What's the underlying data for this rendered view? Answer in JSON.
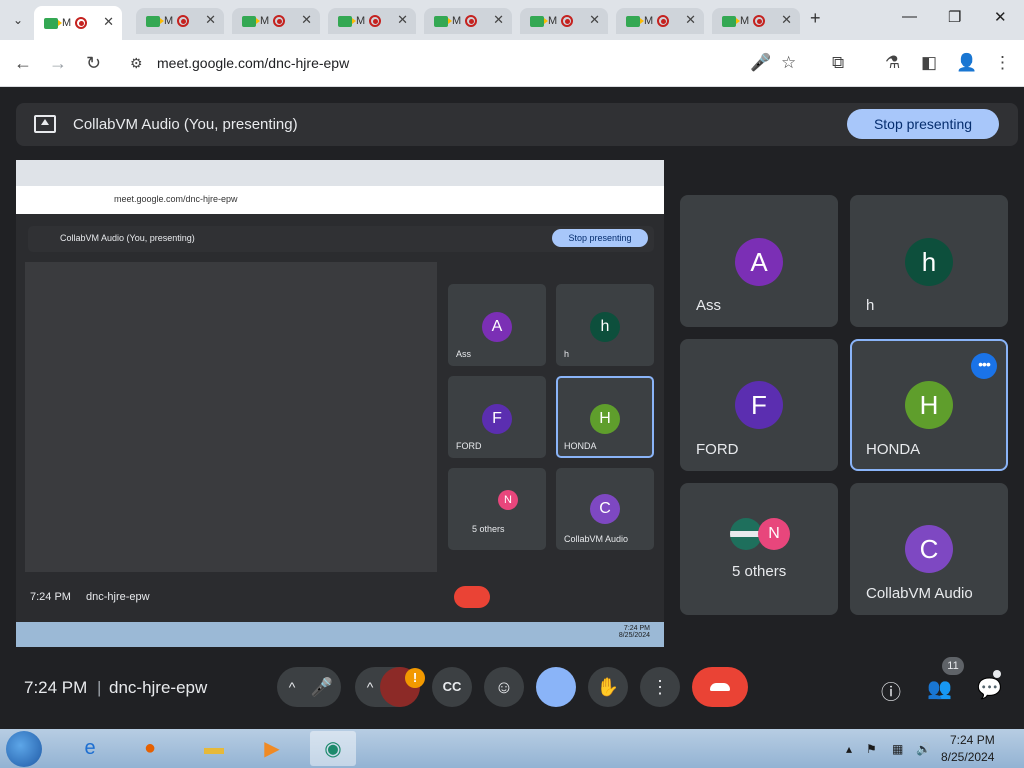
{
  "browser": {
    "tab_label": "M",
    "url": "meet.google.com/dnc-hjre-epw",
    "new_tab": "+",
    "close": "✕",
    "minimize": "—",
    "restore": "❐"
  },
  "presenting_bar": {
    "title": "CollabVM Audio (You, presenting)",
    "stop_label": "Stop presenting"
  },
  "participants": [
    {
      "initial": "A",
      "name": "Ass",
      "color": "#7b2fb5"
    },
    {
      "initial": "h",
      "name": "h",
      "color": "#0d4f3c"
    },
    {
      "initial": "F",
      "name": "FORD",
      "color": "#5b2eb0"
    },
    {
      "initial": "H",
      "name": "HONDA",
      "color": "#5f9e2c"
    },
    {
      "initial": "N",
      "name": "5 others",
      "color": "#e8467c"
    },
    {
      "initial": "C",
      "name": "CollabVM Audio",
      "color": "#7e48c2"
    }
  ],
  "footer": {
    "time": "7:24 PM",
    "separator": "|",
    "meeting_code": "dnc-hjre-epw",
    "warning": "!",
    "people_count": "11"
  },
  "nested": {
    "stop_label": "Stop presenting",
    "clock_time": "7:24 PM",
    "clock_date": "8/25/2024"
  },
  "taskbar": {
    "clock_time": "7:24 PM",
    "clock_date": "8/25/2024"
  },
  "icons": {
    "back": "←",
    "forward": "→",
    "reload": "↻",
    "site": "⚙",
    "mic": "🎤",
    "star": "☆",
    "ext": "⧉",
    "lab": "⚗",
    "side": "◧",
    "profile": "👤",
    "menu": "⋮",
    "chevron": "^",
    "cc": "CC",
    "emoji": "☺",
    "hand": "✋",
    "more": "⋮",
    "info": "ⓘ",
    "people": "👥",
    "chat": "💬"
  }
}
